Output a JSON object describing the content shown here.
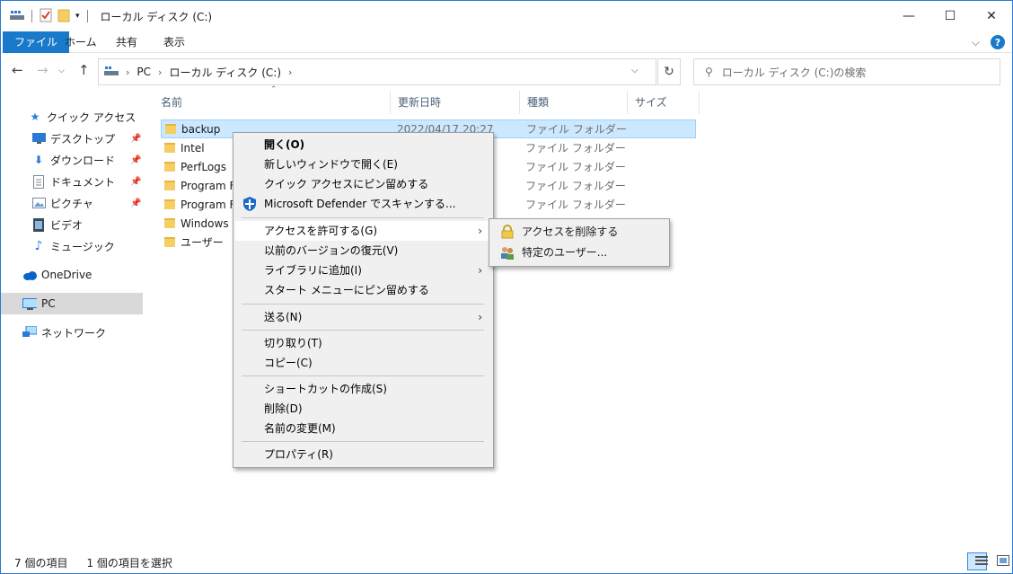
{
  "window": {
    "title": "ローカル ディスク (C:)",
    "controls": {
      "minimize": "—",
      "maximize": "☐",
      "close": "✕"
    }
  },
  "ribbon": {
    "tabs": [
      "ファイル",
      "ホーム",
      "共有",
      "表示"
    ],
    "help": "?",
    "expand": "⌵"
  },
  "address": {
    "segments": [
      "PC",
      "ローカル ディスク (C:)"
    ],
    "search_placeholder": "ローカル ディスク (C:)の検索"
  },
  "sidebar": {
    "items": [
      {
        "label": "クイック アクセス",
        "icon": "star-icon"
      },
      {
        "label": "デスクトップ",
        "icon": "desktop-icon",
        "pinned": true
      },
      {
        "label": "ダウンロード",
        "icon": "download-icon",
        "pinned": true
      },
      {
        "label": "ドキュメント",
        "icon": "document-icon",
        "pinned": true
      },
      {
        "label": "ピクチャ",
        "icon": "picture-icon",
        "pinned": true
      },
      {
        "label": "ビデオ",
        "icon": "video-icon"
      },
      {
        "label": "ミュージック",
        "icon": "music-icon"
      },
      {
        "label": "OneDrive",
        "icon": "cloud-icon"
      },
      {
        "label": "PC",
        "icon": "pc-icon",
        "selected": true
      },
      {
        "label": "ネットワーク",
        "icon": "network-icon"
      }
    ]
  },
  "filelist": {
    "columns": [
      "名前",
      "更新日時",
      "種類",
      "サイズ"
    ],
    "rows": [
      {
        "name": "backup",
        "date": "2022/04/17 20:27",
        "type": "ファイル フォルダー",
        "selected": true
      },
      {
        "name": "Intel",
        "date": "",
        "type": "ファイル フォルダー"
      },
      {
        "name": "PerfLogs",
        "date": "",
        "type": "ファイル フォルダー"
      },
      {
        "name": "Program Fi",
        "date": "",
        "type": "ファイル フォルダー"
      },
      {
        "name": "Program Fi",
        "date": "",
        "type": "ファイル フォルダー"
      },
      {
        "name": "Windows",
        "date": "",
        "type": ""
      },
      {
        "name": "ユーザー",
        "date": "",
        "type": ""
      }
    ]
  },
  "context_menu": {
    "items": [
      {
        "label": "開く(O)",
        "bold": true
      },
      {
        "label": "新しいウィンドウで開く(E)"
      },
      {
        "label": "クイック アクセスにピン留めする"
      },
      {
        "label": "Microsoft Defender でスキャンする...",
        "icon": "defender-shield-icon"
      },
      {
        "label": "アクセスを許可する(G)",
        "submenu": true,
        "hover": true
      },
      {
        "label": "以前のバージョンの復元(V)"
      },
      {
        "label": "ライブラリに追加(I)",
        "submenu": true
      },
      {
        "label": "スタート メニューにピン留めする"
      },
      {
        "label": "送る(N)",
        "submenu": true
      },
      {
        "label": "切り取り(T)"
      },
      {
        "label": "コピー(C)"
      },
      {
        "label": "ショートカットの作成(S)"
      },
      {
        "label": "削除(D)"
      },
      {
        "label": "名前の変更(M)"
      },
      {
        "label": "プロパティ(R)"
      }
    ]
  },
  "submenu": {
    "items": [
      {
        "label": "アクセスを削除する",
        "icon": "lock-icon"
      },
      {
        "label": "特定のユーザー...",
        "icon": "users-icon"
      }
    ]
  },
  "status": {
    "count": "7 個の項目",
    "selected": "1 個の項目を選択"
  },
  "colors": {
    "accent": "#1979ca",
    "selection": "#cce8ff",
    "folder": "#f5cf63"
  }
}
